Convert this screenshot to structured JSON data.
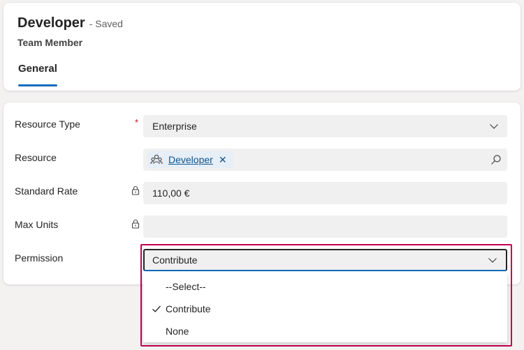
{
  "header": {
    "title": "Developer",
    "saved_status": "- Saved",
    "entity": "Team Member",
    "tab_general": "General"
  },
  "form": {
    "resource_type": {
      "label": "Resource Type",
      "required": "*",
      "value": "Enterprise"
    },
    "resource": {
      "label": "Resource",
      "tag": "Developer",
      "remove": "✕"
    },
    "standard_rate": {
      "label": "Standard Rate",
      "value": "110,00 €"
    },
    "max_units": {
      "label": "Max Units",
      "value": ""
    },
    "permission": {
      "label": "Permission",
      "value": "Contribute",
      "options": [
        "--Select--",
        "Contribute",
        "None"
      ],
      "selected_index": 1
    }
  },
  "colors": {
    "accent": "#0f6cbd",
    "highlight": "#c30052",
    "required": "#c50f1f",
    "link": "#0f548c"
  }
}
